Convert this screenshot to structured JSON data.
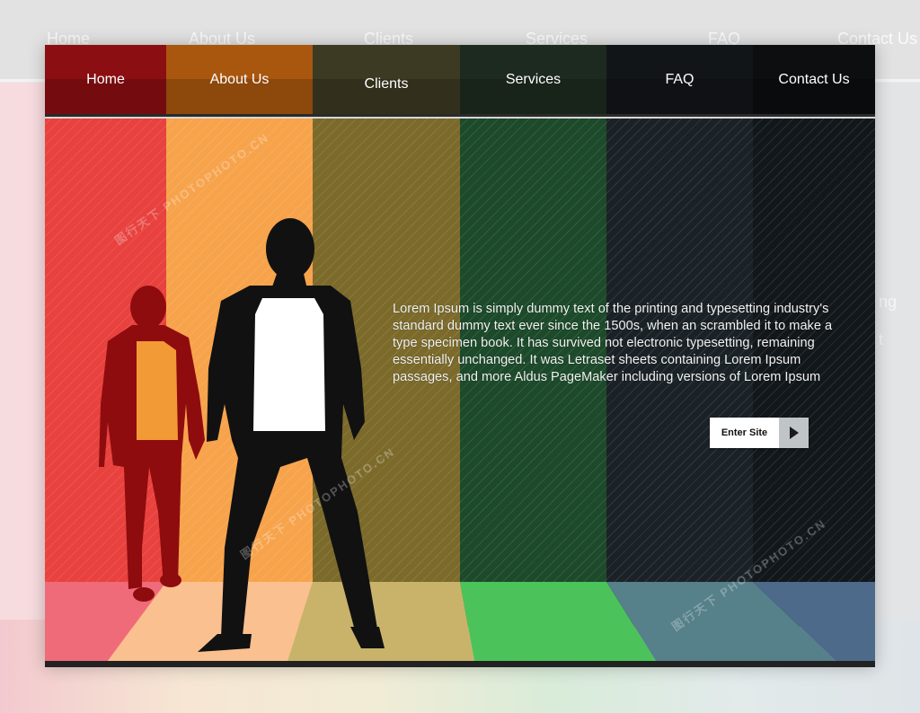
{
  "nav": {
    "items": [
      {
        "label": "Home",
        "color": "#8b0f12"
      },
      {
        "label": "About Us",
        "color": "#a9560f"
      },
      {
        "label": "Clients",
        "color": "#3c3a22"
      },
      {
        "label": "Services",
        "color": "#1d2a20"
      },
      {
        "label": "FAQ",
        "color": "#121518"
      },
      {
        "label": "Contact Us",
        "color": "#0c0e10"
      }
    ]
  },
  "background": {
    "nav_labels": [
      "Home",
      "About Us",
      "Clients",
      "Services",
      "FAQ",
      "Contact Us"
    ],
    "stripe_colors": [
      "#f7dcdf",
      "#f6e9dc",
      "#eeeadb",
      "#dde9df",
      "#e6e8e8",
      "#e3e4e6"
    ],
    "side_text": [
      "ng",
      "t"
    ]
  },
  "hero": {
    "stripe_colors": [
      "#e8413e",
      "#f7a34b",
      "#7b6a2a",
      "#1c4a2a",
      "#1b2227",
      "#12171b"
    ],
    "floor_colors": [
      "#f06b7a",
      "#fbc08f",
      "#c9b36a",
      "#4cc35a",
      "#56808a",
      "#4d6a8a"
    ],
    "paragraph": "Lorem Ipsum is simply dummy text of the printing and typesetting industry's standard dummy text ever since the 1500s, when an scrambled it to make a type specimen book. It has survived not electronic typesetting, remaining essentially unchanged. It was Letraset sheets containing Lorem Ipsum passages, and more Aldus PageMaker including versions of Lorem Ipsum",
    "enter_button": {
      "label": "Enter Site",
      "icon": "play-arrow-icon"
    }
  },
  "watermarks": [
    "图行天下",
    "PHOTOPHOTO.CN"
  ]
}
